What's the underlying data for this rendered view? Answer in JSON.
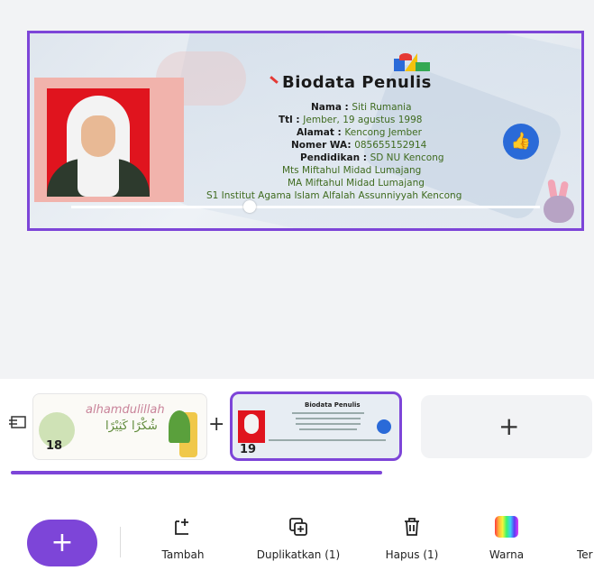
{
  "slide": {
    "title": "Biodata Penulis",
    "lines": [
      {
        "label": "Nama : ",
        "value": "Siti Rumania"
      },
      {
        "label": "Ttl : ",
        "value": "Jember, 19 agustus 1998"
      },
      {
        "label": "Alamat : ",
        "value": "Kencong Jember"
      },
      {
        "label": "Nomer WA: ",
        "value": "085655152914"
      },
      {
        "label": "Pendidikan : ",
        "value": "SD NU Kencong"
      }
    ],
    "education": [
      "Mts Miftahul Midad Lumajang",
      "MA Miftahul Midad Lumajang",
      "S1 Institut Agama Islam Alfalah Assunniyyah Kencong"
    ],
    "progress_fraction": 0.38
  },
  "thumbnails": {
    "items": [
      {
        "number": "18",
        "caption_latin": "alhamdulillah",
        "caption_arabic": "شُكْرًا كَثِيْرًا"
      },
      {
        "number": "19",
        "mini_title": "Biodata Penulis"
      }
    ],
    "add_icon": "+",
    "between_add_icon": "+"
  },
  "toolbar": {
    "fab_icon": "+",
    "items": [
      {
        "label": "Tambah",
        "icon": "add-page-icon"
      },
      {
        "label": "Duplikatkan (1)",
        "icon": "duplicate-icon"
      },
      {
        "label": "Hapus (1)",
        "icon": "trash-icon"
      },
      {
        "label": "Warna",
        "icon": "color-icon"
      },
      {
        "label": "Ter",
        "icon": "more-icon"
      }
    ]
  },
  "colors": {
    "accent": "#7d45d8",
    "photo_background": "#e0141e",
    "value_text": "#3f6b1f",
    "like_badge": "#2a6ad8"
  }
}
